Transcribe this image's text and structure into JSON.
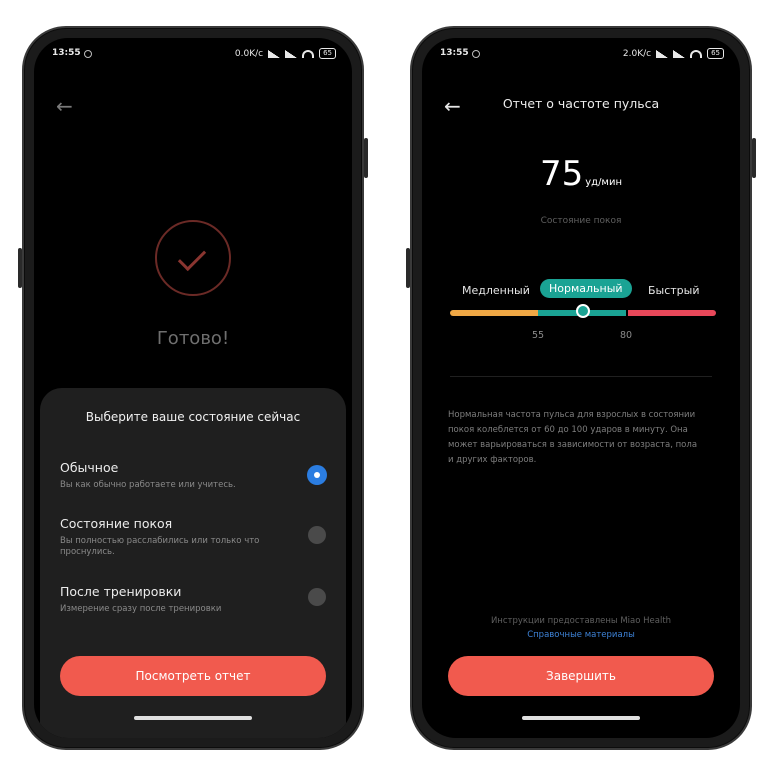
{
  "left_phone": {
    "status": {
      "time": "13:55",
      "speed": "0.0K/c",
      "battery": "65"
    },
    "done_text": "Готово!",
    "sheet": {
      "title": "Выберите ваше состояние сейчас",
      "options": [
        {
          "title": "Обычное",
          "desc": "Вы как обычно работаете или учитесь.",
          "selected": true
        },
        {
          "title": "Состояние покоя",
          "desc": "Вы полностью расслабились или только что проснулись.",
          "selected": false
        },
        {
          "title": "После тренировки",
          "desc": "Измерение сразу после тренировки",
          "selected": false
        }
      ],
      "button_label": "Посмотреть отчет"
    }
  },
  "right_phone": {
    "status": {
      "time": "13:55",
      "speed": "2.0K/c",
      "battery": "65"
    },
    "title": "Отчет о частоте пульса",
    "bpm_value": "75",
    "bpm_unit": "уд/мин",
    "state_label": "Состояние покоя",
    "zones": {
      "slow": "Медленный",
      "normal": "Нормальный",
      "fast": "Быстрый"
    },
    "ticks": {
      "low": "55",
      "high": "80"
    },
    "description": "Нормальная частота пульса для взрослых в состоянии покоя колеблется от 60 до 100 ударов в минуту. Она может варьироваться в зависимости от возраста, пола и других факторов.",
    "credit": "Инструкции предоставлены Miao Health",
    "link": "Справочные материалы",
    "button_label": "Завершить"
  },
  "colors": {
    "accent_red": "#f15a4e",
    "teal": "#1aa394",
    "orange": "#f0a845",
    "red_zone": "#e8485a",
    "radio_blue": "#2b7de1",
    "link_blue": "#3d82d6"
  },
  "icons": [
    "back-arrow-icon",
    "check-icon",
    "signal-icon",
    "wifi-icon",
    "battery-icon"
  ]
}
